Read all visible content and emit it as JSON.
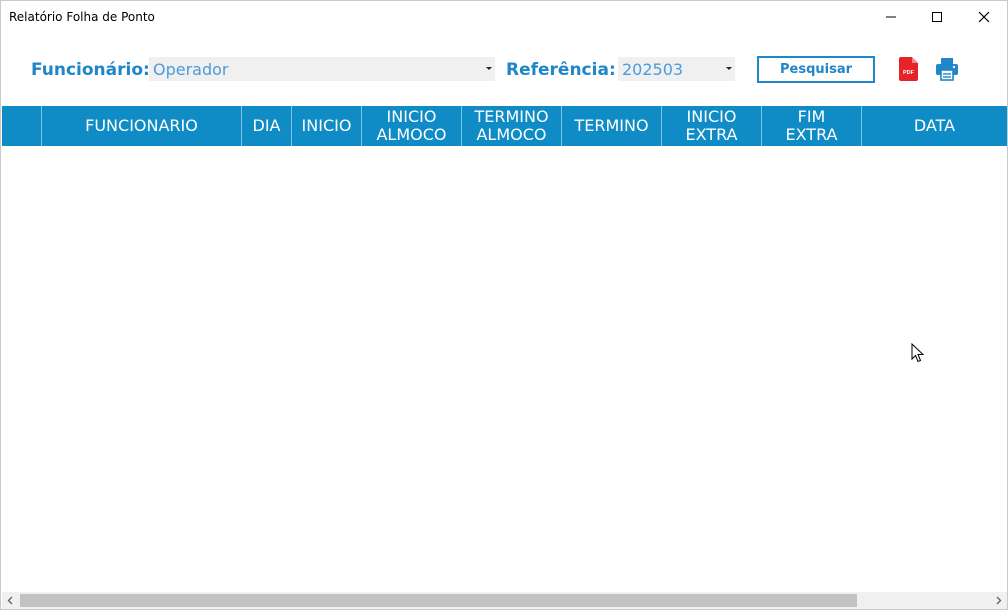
{
  "window": {
    "title": "Relatório Folha de Ponto"
  },
  "filters": {
    "funcionario_label": "Funcionário:",
    "funcionario_value": "Operador",
    "referencia_label": "Referência:",
    "referencia_value": "202503"
  },
  "toolbar": {
    "search_label": "Pesquisar",
    "pdf_icon": "pdf-icon",
    "print_icon": "printer-icon",
    "pdf_text": "PDF"
  },
  "grid": {
    "columns": [
      "",
      "FUNCIONARIO",
      "DIA",
      "INICIO",
      "INICIO\nALMOCO",
      "TERMINO\nALMOCO",
      "TERMINO",
      "INICIO\nEXTRA",
      "FIM\nEXTRA",
      "DATA"
    ],
    "rows": []
  },
  "colors": {
    "accent": "#1e86c9",
    "header_bg": "#0f8cc6"
  }
}
